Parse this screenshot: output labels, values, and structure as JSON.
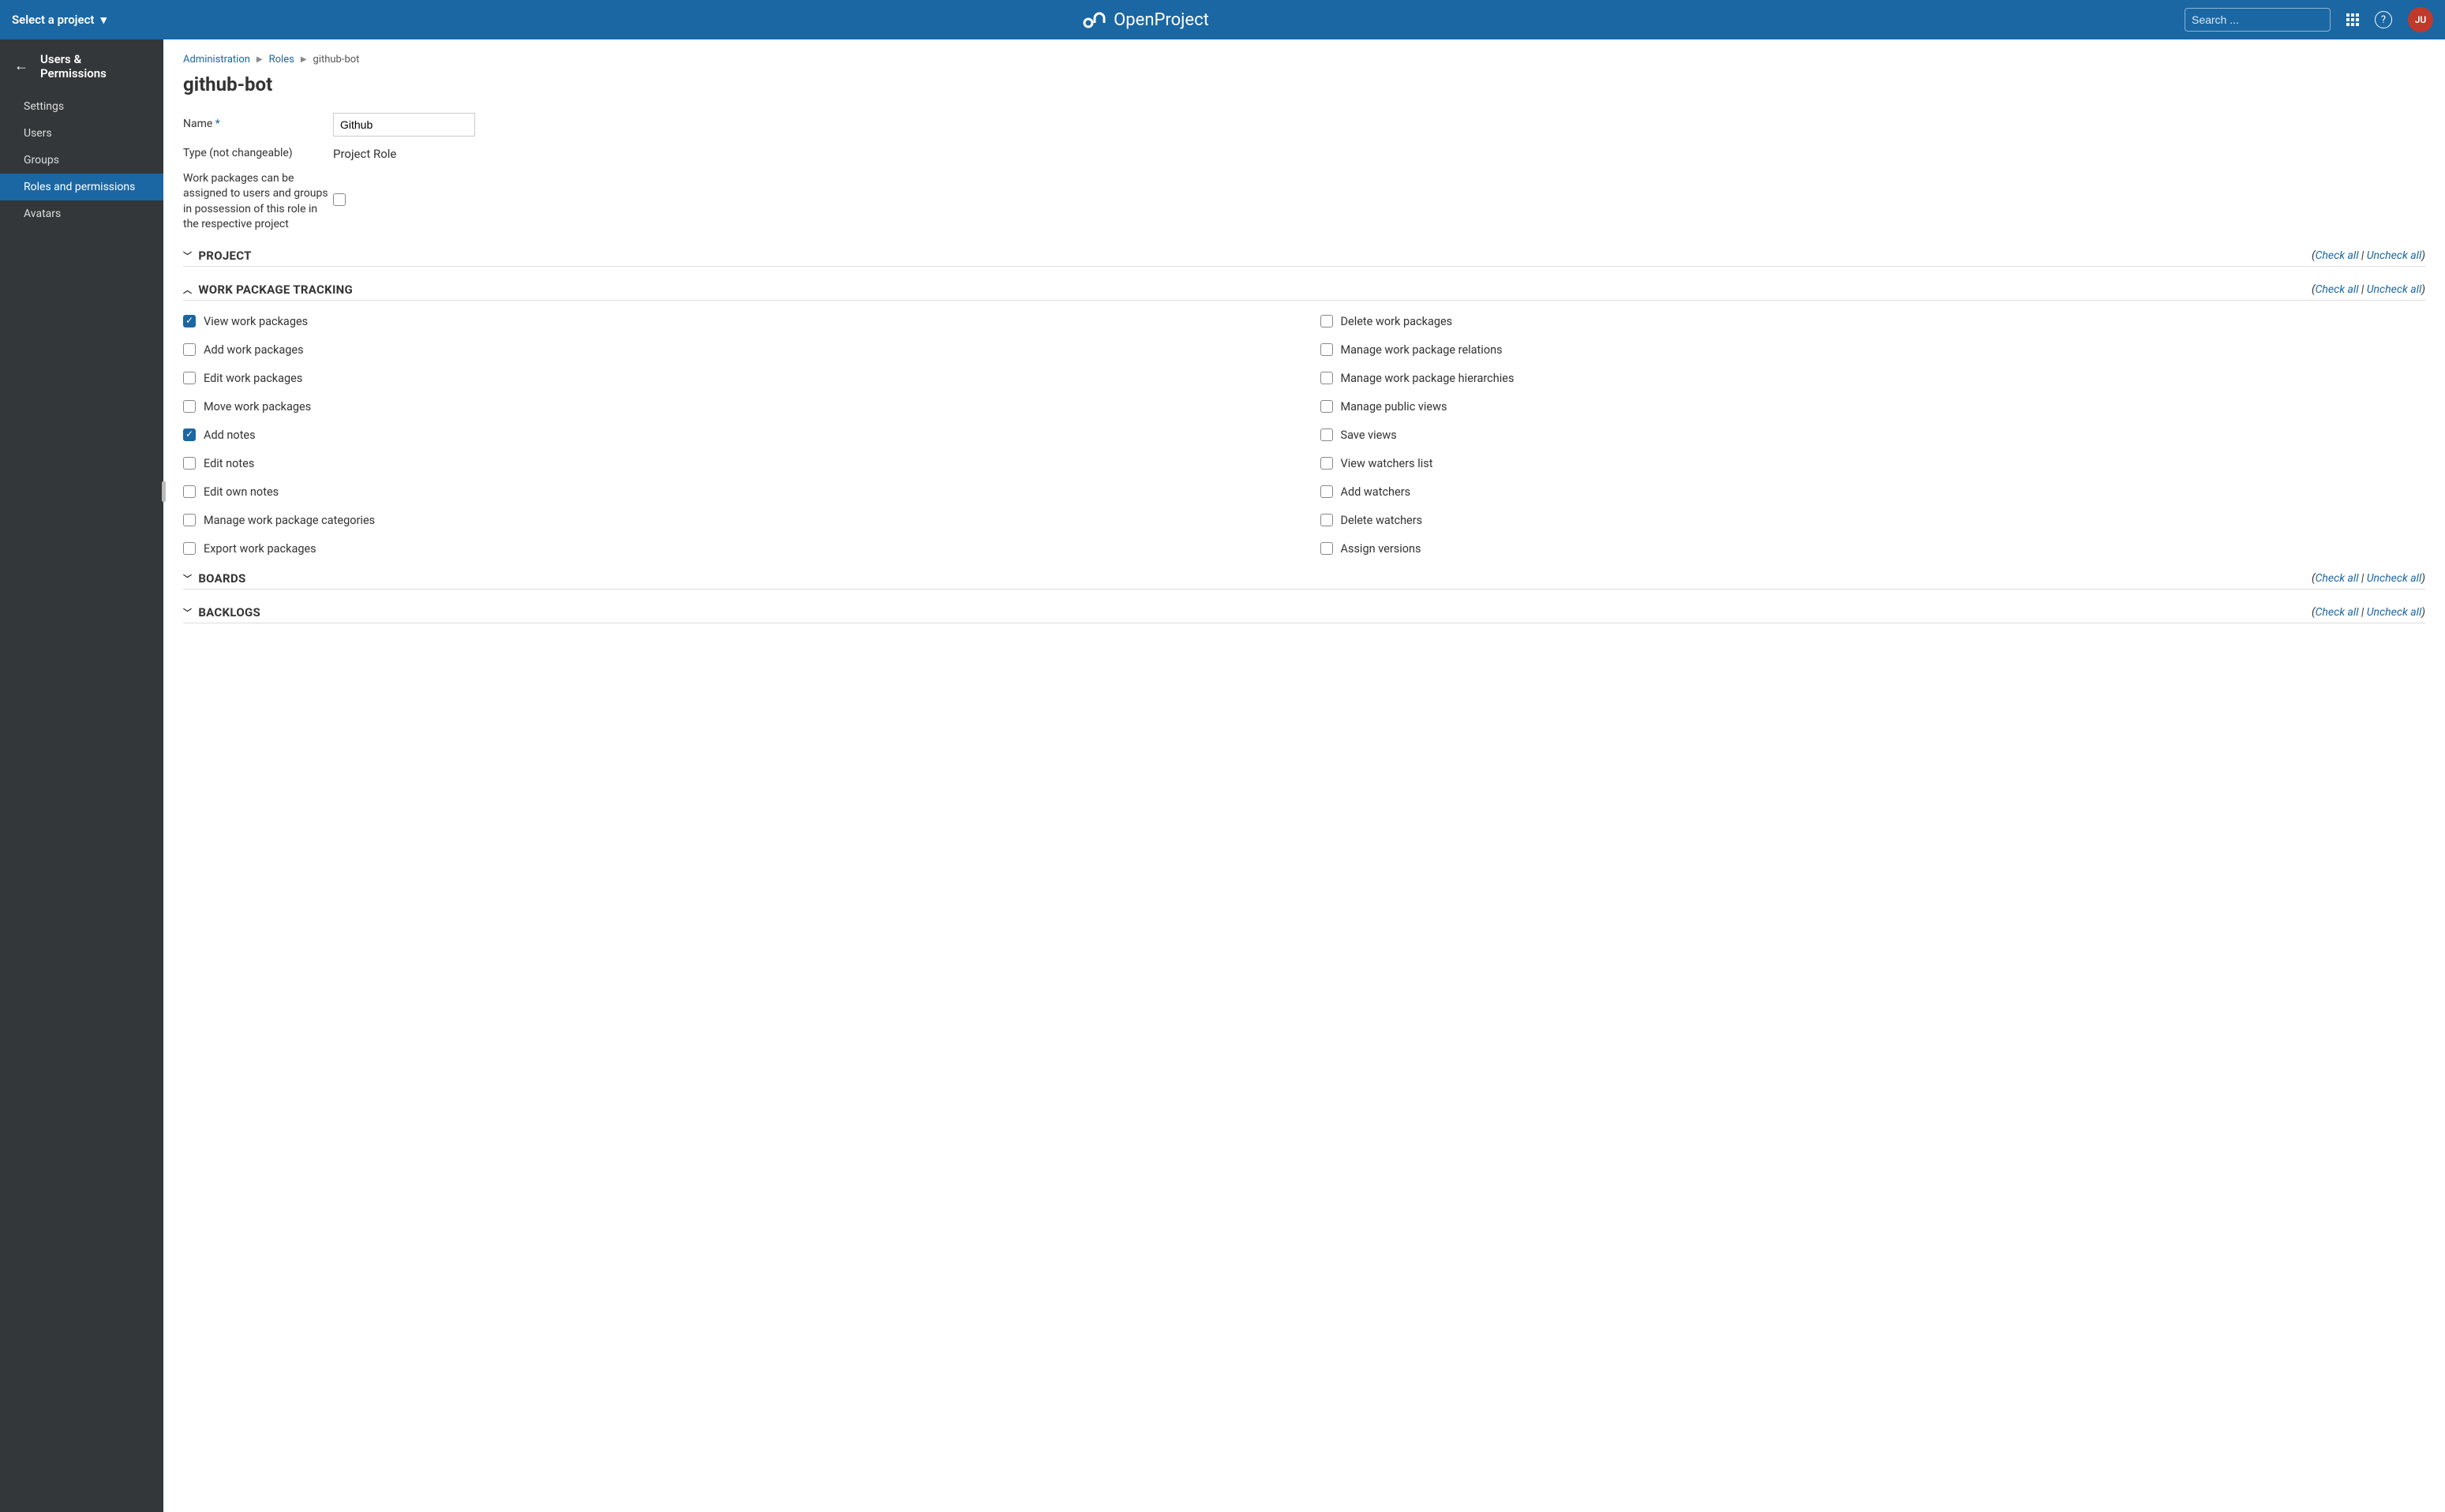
{
  "header": {
    "project_selector": "Select a project",
    "brand": "OpenProject",
    "search_placeholder": "Search ...",
    "avatar_initials": "JU"
  },
  "sidebar": {
    "title": "Users & Permissions",
    "items": [
      {
        "label": "Settings",
        "active": false
      },
      {
        "label": "Users",
        "active": false
      },
      {
        "label": "Groups",
        "active": false
      },
      {
        "label": "Roles and permissions",
        "active": true
      },
      {
        "label": "Avatars",
        "active": false
      }
    ]
  },
  "breadcrumb": {
    "items": [
      "Administration",
      "Roles",
      "github-bot"
    ]
  },
  "page": {
    "title": "github-bot",
    "name_label": "Name",
    "name_value": "Github",
    "type_label": "Type (not changeable)",
    "type_value": "Project Role",
    "assignable_label": "Work packages can be assigned to users and groups in possession of this role in the respective project",
    "assignable_checked": false
  },
  "sections": [
    {
      "title": "PROJECT",
      "expanded": false,
      "check_all": "Check all",
      "uncheck_all": "Uncheck all"
    },
    {
      "title": "WORK PACKAGE TRACKING",
      "expanded": true,
      "check_all": "Check all",
      "uncheck_all": "Uncheck all",
      "permissions_left": [
        {
          "label": "View work packages",
          "checked": true
        },
        {
          "label": "Add work packages",
          "checked": false
        },
        {
          "label": "Edit work packages",
          "checked": false
        },
        {
          "label": "Move work packages",
          "checked": false
        },
        {
          "label": "Add notes",
          "checked": true
        },
        {
          "label": "Edit notes",
          "checked": false
        },
        {
          "label": "Edit own notes",
          "checked": false
        },
        {
          "label": "Manage work package categories",
          "checked": false
        },
        {
          "label": "Export work packages",
          "checked": false
        }
      ],
      "permissions_right": [
        {
          "label": "Delete work packages",
          "checked": false
        },
        {
          "label": "Manage work package relations",
          "checked": false
        },
        {
          "label": "Manage work package hierarchies",
          "checked": false
        },
        {
          "label": "Manage public views",
          "checked": false
        },
        {
          "label": "Save views",
          "checked": false
        },
        {
          "label": "View watchers list",
          "checked": false
        },
        {
          "label": "Add watchers",
          "checked": false
        },
        {
          "label": "Delete watchers",
          "checked": false
        },
        {
          "label": "Assign versions",
          "checked": false
        }
      ]
    },
    {
      "title": "BOARDS",
      "expanded": false,
      "check_all": "Check all",
      "uncheck_all": "Uncheck all"
    },
    {
      "title": "BACKLOGS",
      "expanded": false,
      "check_all": "Check all",
      "uncheck_all": "Uncheck all"
    }
  ]
}
